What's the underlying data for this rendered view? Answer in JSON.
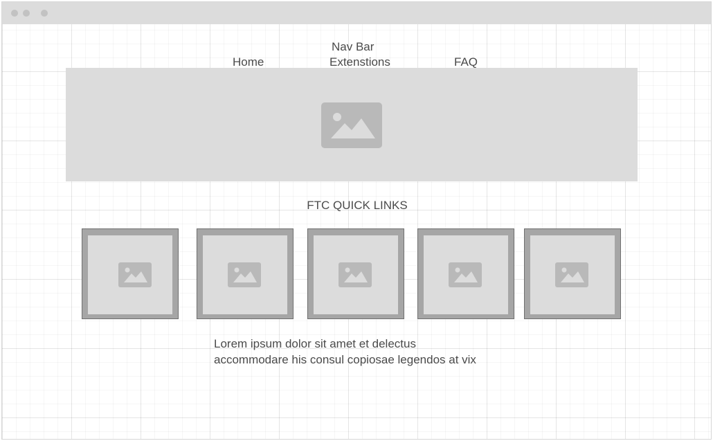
{
  "window": {
    "controls": [
      "close",
      "minimize",
      "maximize"
    ]
  },
  "nav": {
    "title": "Nav Bar",
    "links": [
      "Home",
      "Extenstions",
      "FAQ"
    ]
  },
  "hero": {
    "icon": "image-placeholder-icon"
  },
  "quick_links": {
    "title": "FTC QUICK LINKS",
    "tiles": [
      "image-placeholder-icon",
      "image-placeholder-icon",
      "image-placeholder-icon",
      "image-placeholder-icon",
      "image-placeholder-icon"
    ]
  },
  "description": {
    "line1": "Lorem ipsum dolor sit amet et delectus",
    "line2": "accommodare his consul copiosae legendos at vix"
  },
  "colors": {
    "placeholder_fill": "#dcdcdc",
    "icon_fill": "#b9b9b9",
    "tile_frame": "#a6a6a6",
    "text": "#4a4a4a"
  }
}
